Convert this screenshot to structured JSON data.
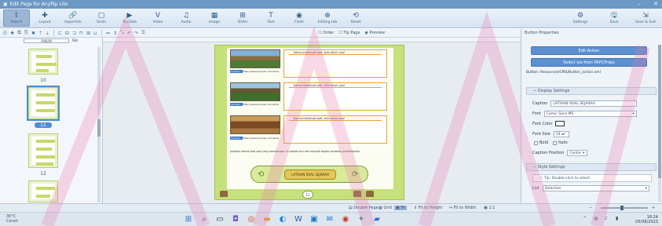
{
  "window": {
    "title": "Edit Page for Anyflip Lite",
    "min": "–",
    "close": "✕"
  },
  "ribbon": {
    "items": [
      {
        "label": "Import",
        "icon": "⇪",
        "active": true
      },
      {
        "label": "Layout",
        "icon": "✚"
      },
      {
        "label": "Hyperlink",
        "icon": "🔗"
      },
      {
        "label": "Scale",
        "icon": "▢"
      },
      {
        "label": "YouTube",
        "icon": "▶"
      },
      {
        "label": "Video",
        "icon": "V"
      },
      {
        "label": "Audio",
        "icon": "♫"
      },
      {
        "label": "Image",
        "icon": "▦"
      },
      {
        "label": "Slider",
        "icon": "⊞"
      },
      {
        "label": "Text",
        "icon": "T"
      },
      {
        "label": "Flash",
        "icon": "◉"
      },
      {
        "label": "Editing tab",
        "icon": "⊕"
      },
      {
        "label": "Reset",
        "icon": "⟲"
      }
    ],
    "right_items": [
      {
        "label": "Settings",
        "icon": "⚙"
      },
      {
        "label": "Save",
        "icon": "🖫"
      },
      {
        "label": "Save & Exit",
        "icon": "⇲"
      }
    ]
  },
  "toolbar2": {
    "options": [
      "Order",
      "Tip Page",
      "Preview"
    ]
  },
  "pages_panel": {
    "header": "ANKAN",
    "page_numbers": [
      "10",
      "11",
      "12"
    ],
    "selected": "11"
  },
  "page_content": {
    "questions": [
      "Kamu-membuat soal, tulis disini yaa!",
      "Kamu-membuat soal, tulis disini yaa!",
      "Kamu-membuat soal, tulis disini yaa!"
    ],
    "sources": [
      {
        "tag": "Sumber: ",
        "text": "https://www.kompas.com/skola"
      },
      {
        "tag": "Sumber: ",
        "text": "https://www.kompas.com/skola"
      },
      {
        "tag": "Sumber: ",
        "text": "https://www.kompas.com/skola"
      }
    ],
    "paragraph": "Jelaskan bahwa soal-soal yang membangun ini adalah kuis dan menjadi bagian penilaian pembelajaran.",
    "button_label": "LATIHAN SOAL SEJARAH",
    "page_badge": "11"
  },
  "props_panel": {
    "header": "Button Properties",
    "btn_edit": "Edit Action",
    "btn_select": "Select via from PAPCProps",
    "file_label": "Button: Resources/CMS/Button_action.xml",
    "group_display": "Display Settings",
    "caption_label": "Caption",
    "caption_value": "LATIHAN SOAL SEJARAH",
    "font_label": "Font",
    "font_value": "Comic Sans MS",
    "font_color_label": "Font Color",
    "font_size_label": "Font Size",
    "font_size_value": "14",
    "bold_label": "Bold",
    "italic_label": "Italic",
    "caption_pos_label": "Caption Position",
    "caption_pos_value": "Center",
    "group_style": "Style Settings",
    "hint": "Tip: Double-click to select",
    "list_label": "List",
    "list_value": "Selection"
  },
  "statusbar": {
    "double_page": "Double Page",
    "grid": "Grid",
    "fit": "Fit",
    "fit_height": "Fit to Height",
    "fit_width": "Fit to Width",
    "ratio": "1:1"
  },
  "taskbar": {
    "weather_temp": "30°C",
    "weather_desc": "Cerah",
    "time": "18:24",
    "date": "05/08/2023",
    "icons": [
      "windows-icon",
      "search-icon",
      "task-view-icon",
      "chat-icon",
      "chrome-icon",
      "explorer-icon",
      "edge-icon",
      "word-icon",
      "store-icon",
      "mail-icon",
      "photos-icon",
      "anyflip-icon"
    ]
  },
  "colors": {
    "accent": "#4f8ed0",
    "titlebar": "#6b98c4",
    "page_green": "#c6e07b",
    "question_border": "#e6a43c"
  }
}
